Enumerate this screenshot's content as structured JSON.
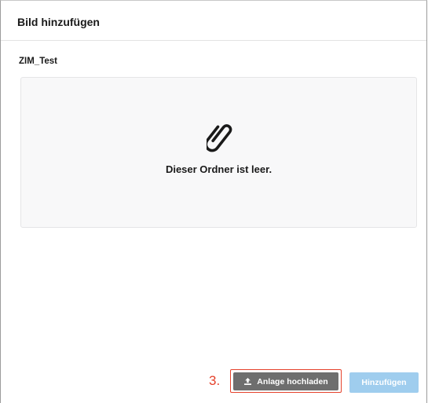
{
  "dialog": {
    "title": "Bild hinzufügen",
    "folder_name": "ZIM_Test",
    "empty_message": "Dieser Ordner ist leer.",
    "empty_icon": "paperclip-icon"
  },
  "footer": {
    "step_label": "3.",
    "upload_label": "Anlage hochladen",
    "upload_icon": "upload-icon",
    "add_label": "Hinzufügen",
    "add_enabled": false
  },
  "colors": {
    "annotation_red": "#e5412b",
    "upload_button_bg": "#6e6e6e",
    "add_button_bg_disabled": "#9fcdee"
  }
}
